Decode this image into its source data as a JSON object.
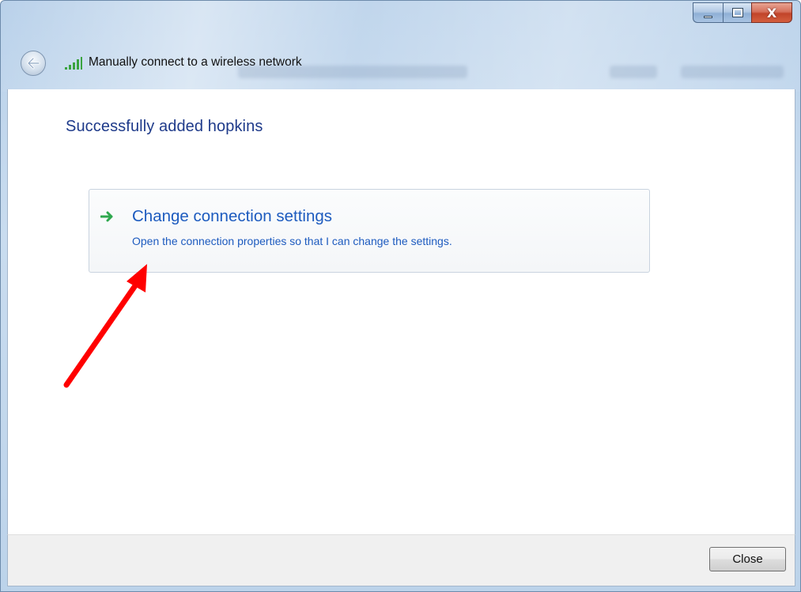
{
  "window": {
    "title": "Manually connect to a wireless network",
    "caption_buttons": [
      "minimize-icon",
      "maximize-icon",
      "close-icon"
    ],
    "close_glyph": "X"
  },
  "header": {
    "back_icon": "back-arrow-icon",
    "network_icon": "wireless-signal-icon"
  },
  "main": {
    "heading": "Successfully added hopkins",
    "option": {
      "icon": "green-arrow-icon",
      "title": "Change connection settings",
      "description": "Open the connection properties so that I can change the settings."
    }
  },
  "footer": {
    "close_label": "Close"
  },
  "colors": {
    "heading": "#1e3a8a",
    "link": "#1d5bbf",
    "annotation_arrow": "#ff0000",
    "option_arrow": "#2fa84f"
  }
}
